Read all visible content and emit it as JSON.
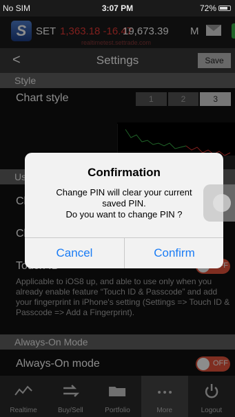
{
  "status_bar": {
    "carrier": "No SIM",
    "time": "3:07 PM",
    "battery": "72%"
  },
  "ticker": {
    "logo": "S",
    "index": "SET",
    "change": "1,363.18 -16.47",
    "value": "19,673.39",
    "unit": "M",
    "url": "realtimetest.settrade.com"
  },
  "nav": {
    "back": "<",
    "title": "Settings",
    "save_label": "Save"
  },
  "settings": {
    "style_header": "Style",
    "chart_style_label": "Chart style",
    "chart_style_options": [
      "1",
      "2",
      "3"
    ],
    "chart_style_selected": "3",
    "user_header_partial": "Us",
    "row1_partial": "Cl",
    "row2_partial": "Cl",
    "touch_id_label": "Touch ID",
    "touch_id_toggle": "OFF",
    "touch_id_desc": "Applicable to iOS8 up, and able to use only when you already enable feature “Touch ID & Passcode” and add your fingerprint in iPhone's setting (Settings => Touch ID & Passcode => Add a Fingerprint).",
    "always_on_header": "Always-On Mode",
    "always_on_label": "Always-On mode",
    "always_on_toggle": "OFF"
  },
  "tabs": [
    {
      "label": "Realtime",
      "icon": "chart-line-icon"
    },
    {
      "label": "Buy/Sell",
      "icon": "buy-sell-arrows-icon"
    },
    {
      "label": "Portfolio",
      "icon": "folder-icon"
    },
    {
      "label": "More",
      "icon": "more-dots-icon"
    },
    {
      "label": "Logout",
      "icon": "power-icon"
    }
  ],
  "active_tab": "More",
  "dialog": {
    "title": "Confirmation",
    "message_line1": "Change PIN will clear your current",
    "message_line2": "saved PIN.",
    "message_line3": "Do you want to change PIN ?",
    "cancel_label": "Cancel",
    "confirm_label": "Confirm"
  },
  "colors": {
    "accent_blue": "#1a7cf5",
    "toggle_off": "#e8543c",
    "negative": "#e53935"
  }
}
